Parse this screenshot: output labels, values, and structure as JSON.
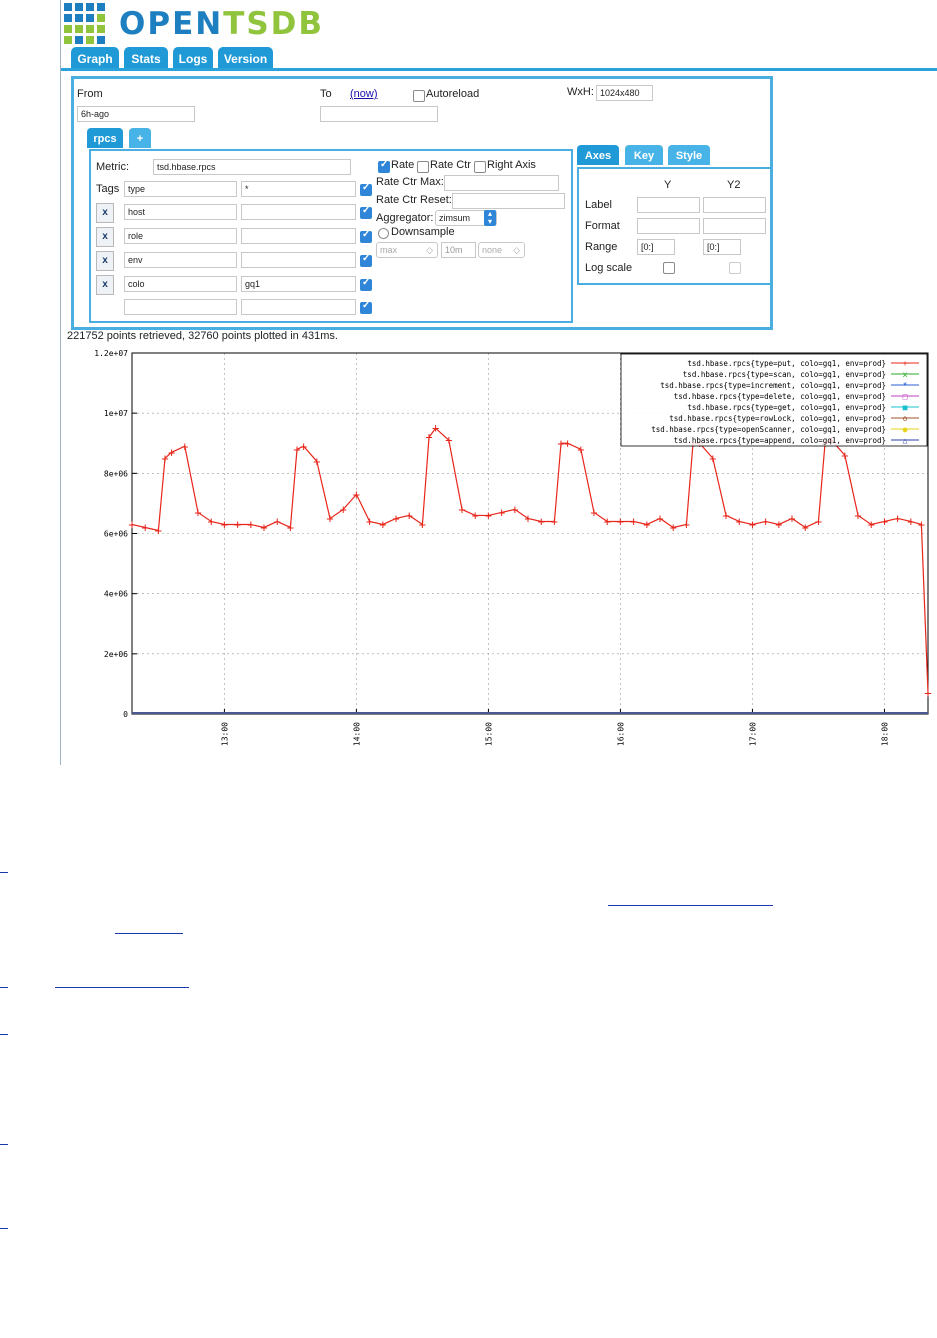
{
  "app": {
    "logo_text": "OPENTSDB",
    "logo_colors": {
      "open": "#1d7fc0",
      "tsdb": "#8fc43c"
    },
    "accent": "#1f9ad6"
  },
  "nav_tabs": [
    {
      "label": "Graph",
      "active": true
    },
    {
      "label": "Stats",
      "active": false
    },
    {
      "label": "Logs",
      "active": false
    },
    {
      "label": "Version",
      "active": false
    }
  ],
  "time": {
    "from_label": "From",
    "from_value": "6h-ago",
    "to_label": "To",
    "now_link": "(now)",
    "to_value": "",
    "autoreload_label": "Autoreload",
    "autoreload_checked": false,
    "wxh_label": "WxH:",
    "wxh_value": "1024x480"
  },
  "query_tabs": [
    {
      "label": "rpcs",
      "active": true
    },
    {
      "label": "+",
      "active": false
    }
  ],
  "metric": {
    "label": "Metric:",
    "value": "tsd.hbase.rpcs",
    "tags_label": "Tags",
    "tags": [
      {
        "key": "type",
        "value": "*",
        "checked": true,
        "removable": false
      },
      {
        "key": "host",
        "value": "",
        "checked": true,
        "removable": true
      },
      {
        "key": "role",
        "value": "",
        "checked": true,
        "removable": true
      },
      {
        "key": "env",
        "value": "",
        "checked": true,
        "removable": true
      },
      {
        "key": "colo",
        "value": "gq1",
        "checked": true,
        "removable": true
      },
      {
        "key": "",
        "value": "",
        "checked": true,
        "removable": false
      }
    ],
    "remove_label": "x"
  },
  "options": {
    "rate_label": "Rate",
    "rate_checked": true,
    "rate_ctr_label": "Rate Ctr",
    "rate_ctr_checked": false,
    "right_axis_label": "Right Axis",
    "right_axis_checked": false,
    "rate_ctr_max_label": "Rate Ctr Max:",
    "rate_ctr_reset_label": "Rate Ctr Reset:",
    "aggregator_label": "Aggregator:",
    "aggregator_value": "zimsum",
    "downsample_label": "Downsample",
    "downsample_checked": false,
    "ds_function": "max",
    "ds_interval": "10m",
    "ds_fill": "none"
  },
  "style_tabs": [
    {
      "label": "Axes",
      "active": true
    },
    {
      "label": "Key",
      "active": false
    },
    {
      "label": "Style",
      "active": false
    }
  ],
  "axes": {
    "col_y": "Y",
    "col_y2": "Y2",
    "label_row": "Label",
    "format_row": "Format",
    "range_row": "Range",
    "log_row": "Log scale",
    "y_range": "[0:]",
    "y2_range": "[0:]"
  },
  "status_text": "221752 points retrieved, 32760 points plotted in 431ms.",
  "chart_data": {
    "type": "line",
    "xlabel": "",
    "ylabel": "",
    "x_ticks": [
      "13:00",
      "14:00",
      "15:00",
      "16:00",
      "17:00",
      "18:00"
    ],
    "x_tick_hours": [
      13,
      14,
      15,
      16,
      17,
      18
    ],
    "x_range_hours": [
      12.3,
      18.33
    ],
    "y_ticks": [
      "0",
      "2e+06",
      "4e+06",
      "6e+06",
      "8e+06",
      "1e+07",
      "1.2e+07"
    ],
    "y_tick_values": [
      0,
      2000000,
      4000000,
      6000000,
      8000000,
      10000000,
      12000000
    ],
    "ylim": [
      0,
      12000000
    ],
    "grid": true,
    "legend_position": "top-right",
    "series": [
      {
        "name": "tsd.hbase.rpcs{type=put, colo=gq1, env=prod}",
        "color": "#e8251a",
        "marker": "+",
        "x_hours": [
          12.3,
          12.4,
          12.5,
          12.55,
          12.6,
          12.7,
          12.8,
          12.9,
          13.0,
          13.1,
          13.2,
          13.3,
          13.4,
          13.5,
          13.55,
          13.6,
          13.7,
          13.8,
          13.9,
          14.0,
          14.1,
          14.2,
          14.3,
          14.4,
          14.5,
          14.55,
          14.6,
          14.7,
          14.8,
          14.9,
          15.0,
          15.1,
          15.2,
          15.3,
          15.4,
          15.5,
          15.55,
          15.6,
          15.7,
          15.8,
          15.9,
          16.0,
          16.1,
          16.2,
          16.3,
          16.4,
          16.5,
          16.55,
          16.6,
          16.7,
          16.8,
          16.9,
          17.0,
          17.1,
          17.2,
          17.3,
          17.4,
          17.5,
          17.55,
          17.6,
          17.7,
          17.8,
          17.9,
          18.0,
          18.1,
          18.2,
          18.28,
          18.33
        ],
        "values": [
          6300000,
          6200000,
          6100000,
          8500000,
          8700000,
          8900000,
          6700000,
          6400000,
          6300000,
          6300000,
          6300000,
          6200000,
          6400000,
          6200000,
          8800000,
          8900000,
          8400000,
          6500000,
          6800000,
          7300000,
          6400000,
          6300000,
          6500000,
          6600000,
          6300000,
          9200000,
          9500000,
          9100000,
          6800000,
          6600000,
          6600000,
          6700000,
          6800000,
          6500000,
          6400000,
          6400000,
          9000000,
          9000000,
          8800000,
          6700000,
          6400000,
          6400000,
          6400000,
          6300000,
          6500000,
          6200000,
          6300000,
          9000000,
          9000000,
          8500000,
          6600000,
          6400000,
          6300000,
          6400000,
          6300000,
          6500000,
          6200000,
          6400000,
          9000000,
          9100000,
          8600000,
          6600000,
          6300000,
          6400000,
          6500000,
          6400000,
          6300000,
          700000
        ]
      },
      {
        "name": "tsd.hbase.rpcs{type=scan, colo=gq1, env=prod}",
        "color": "#2aa82a",
        "marker": "x",
        "values_note_zero": 0
      },
      {
        "name": "tsd.hbase.rpcs{type=increment, colo=gq1, env=prod}",
        "color": "#2b5fd6",
        "marker": "*",
        "values_note_zero": 0
      },
      {
        "name": "tsd.hbase.rpcs{type=delete, colo=gq1, env=prod}",
        "color": "#c040c0",
        "marker": "□",
        "values_note_zero": 0
      },
      {
        "name": "tsd.hbase.rpcs{type=get, colo=gq1, env=prod}",
        "color": "#19c0d0",
        "marker": "■",
        "values_note_zero": 0
      },
      {
        "name": "tsd.hbase.rpcs{type=rowLock, colo=gq1, env=prod}",
        "color": "#a0522d",
        "marker": "o",
        "values_note_zero": 0
      },
      {
        "name": "tsd.hbase.rpcs{type=openScanner, colo=gq1, env=prod}",
        "color": "#e6d21a",
        "marker": "●",
        "values_note_zero": 0
      },
      {
        "name": "tsd.hbase.rpcs{type=append, colo=gq1, env=prod}",
        "color": "#2b3fa8",
        "marker": "△",
        "values_note_zero": 0
      }
    ]
  }
}
